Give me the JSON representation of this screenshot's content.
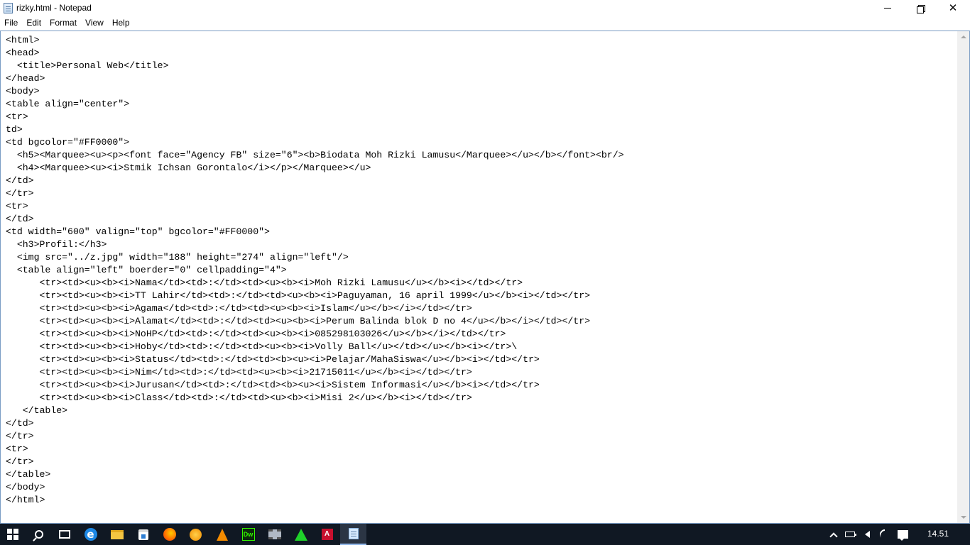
{
  "window": {
    "title": "rizky.html - Notepad",
    "icon": "notepad-icon",
    "controls": {
      "minimize": "minimize-icon",
      "maximize": "restore-icon",
      "close": "close-icon",
      "close_glyph": "✕"
    }
  },
  "menu": {
    "items": [
      {
        "label": "File"
      },
      {
        "label": "Edit"
      },
      {
        "label": "Format"
      },
      {
        "label": "View"
      },
      {
        "label": "Help"
      }
    ]
  },
  "editor": {
    "content": "<html>\n<head>\n  <title>Personal Web</title>\n</head>\n<body>\n<table align=\"center\">\n<tr>\ntd>\n<td bgcolor=\"#FF0000\">\n  <h5><Marquee><u><p><font face=\"Agency FB\" size=\"6\"><b>Biodata Moh Rizki Lamusu</Marquee></u></b></font><br/>\n  <h4><Marquee><u><i>Stmik Ichsan Gorontalo</i></p></Marquee></u>\n</td>\n</tr>\n<tr>\n</td>\n<td width=\"600\" valign=\"top\" bgcolor=\"#FF0000\">\n  <h3>Profil:</h3>\n  <img src=\"../z.jpg\" width=\"188\" height=\"274\" align=\"left\"/>\n  <table align=\"left\" boerder=\"0\" cellpadding=\"4\">\n      <tr><td><u><b><i>Nama</td><td>:</td><td><u><b><i>Moh Rizki Lamusu</u></b><i></td></tr>\n      <tr><td><u><b><i>TT Lahir</td><td>:</td><td><u><b><i>Paguyaman, 16 april 1999</u></b><i></td></tr>\n      <tr><td><u><b><i>Agama</td><td>:</td><td><u><b><i>Islam</u></b></i></td></tr>\n      <tr><td><u><b><i>Alamat</td><td>:</td><td><u><b><i>Perum Balinda blok D no 4</u></b></i></td></tr>\n      <tr><td><u><b><i>NoHP</td><td>:</td><td><u><b><i>085298103026</u></b></i></td></tr>\n      <tr><td><u><b><i>Hoby</td><td>:</td><td><u><b><i>Volly Ball</u></td></u></b><i></tr>\\\n      <tr><td><u><b><i>Status</td><td>:</td><td><b><u><i>Pelajar/MahaSiswa</u></b><i></td></tr>\n      <tr><td><u><b><i>Nim</td><td>:</td><td><u><b><i>21715011</u></b><i></td></tr>\n      <tr><td><u><b><i>Jurusan</td><td>:</td><td><b><u><i>Sistem Informasi</u></b><i></td></tr>\n      <tr><td><u><b><i>Class</td><td>:</td><td><u><b><i>Misi 2</u></b><i></td></tr>\n   </table>\n</td>\n</tr>\n<tr>\n</tr>\n</table>\n</body>\n</html>"
  },
  "taskbar": {
    "items": [
      {
        "name": "start-button",
        "icon": "windows-logo-icon"
      },
      {
        "name": "search-button",
        "icon": "search-icon"
      },
      {
        "name": "task-view-button",
        "icon": "task-view-icon"
      },
      {
        "name": "edge-button",
        "icon": "edge-icon",
        "glyph": "e"
      },
      {
        "name": "file-explorer-button",
        "icon": "folder-icon"
      },
      {
        "name": "store-button",
        "icon": "store-icon"
      },
      {
        "name": "firefox-button",
        "icon": "firefox-icon"
      },
      {
        "name": "flux-button",
        "icon": "flux-icon"
      },
      {
        "name": "vlc-button",
        "icon": "vlc-icon"
      },
      {
        "name": "dreamweaver-button",
        "icon": "dreamweaver-icon",
        "glyph": "Dw"
      },
      {
        "name": "video-app-button",
        "icon": "film-icon"
      },
      {
        "name": "green-app-button",
        "icon": "green-triangle-icon"
      },
      {
        "name": "acrobat-button",
        "icon": "acrobat-icon",
        "glyph": "A"
      },
      {
        "name": "notepad-button",
        "icon": "notepad-icon",
        "active": true
      }
    ],
    "tray": [
      "chevron-up-icon",
      "battery-icon",
      "speaker-icon",
      "wifi-icon",
      "notification-icon"
    ],
    "clock": "14.51"
  },
  "colors": {
    "taskbar_bg": "#101823",
    "editor_border": "#7a9cc4",
    "active_indicator": "#8fb6e8"
  }
}
